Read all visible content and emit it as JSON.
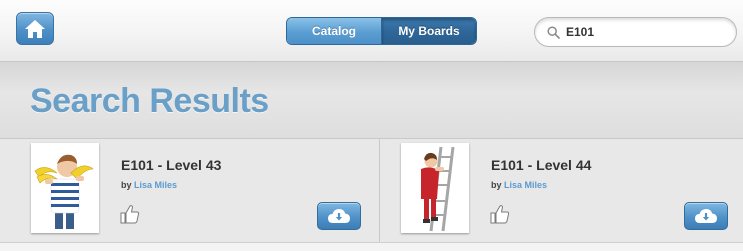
{
  "header": {
    "tabs": [
      {
        "label": "Catalog",
        "selected": false
      },
      {
        "label": "My Boards",
        "selected": true
      }
    ],
    "search": {
      "value": "E101",
      "icon": "search-icon"
    },
    "home_icon": "home-icon",
    "accent_color": "#4e90c7"
  },
  "page": {
    "title": "Search Results",
    "title_color": "#6a9fc8"
  },
  "results": [
    {
      "title": "E101 - Level 43",
      "by_label": "by",
      "author": "Lisa Miles",
      "thumbnail": "boy-with-bananas-image",
      "like_icon": "thumbs-up-icon",
      "download_icon": "cloud-download-icon"
    },
    {
      "title": "E101 - Level 44",
      "by_label": "by",
      "author": "Lisa Miles",
      "thumbnail": "girl-on-ladder-image",
      "like_icon": "thumbs-up-icon",
      "download_icon": "cloud-download-icon"
    }
  ]
}
